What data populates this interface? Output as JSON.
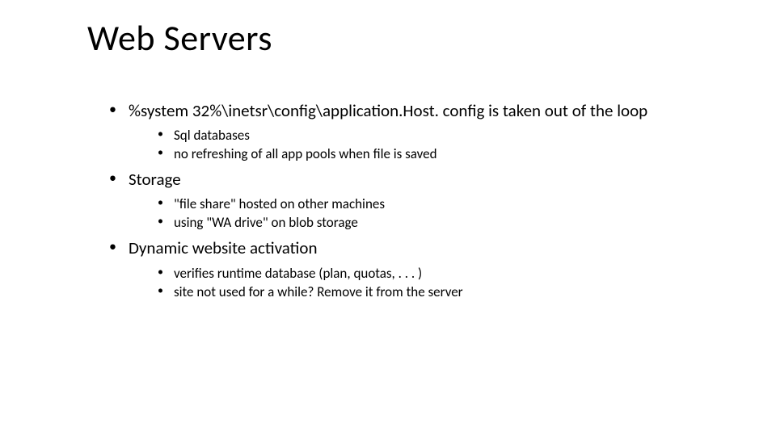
{
  "title": "Web Servers",
  "bullets": [
    {
      "text": "%system 32%\\inetsr\\config\\application.Host. config is taken out of the loop",
      "children": [
        {
          "text": "Sql databases"
        },
        {
          "text": "no refreshing of all app pools when file is saved"
        }
      ]
    },
    {
      "text": "Storage",
      "children": [
        {
          "text": "\"file share\" hosted on other machines"
        },
        {
          "text": "using \"WA drive\" on blob storage"
        }
      ]
    },
    {
      "text": "Dynamic website activation",
      "children": [
        {
          "text": "verifies runtime database (plan, quotas, . . . )"
        },
        {
          "text": "site not used for a while? Remove it from the server"
        }
      ]
    }
  ]
}
